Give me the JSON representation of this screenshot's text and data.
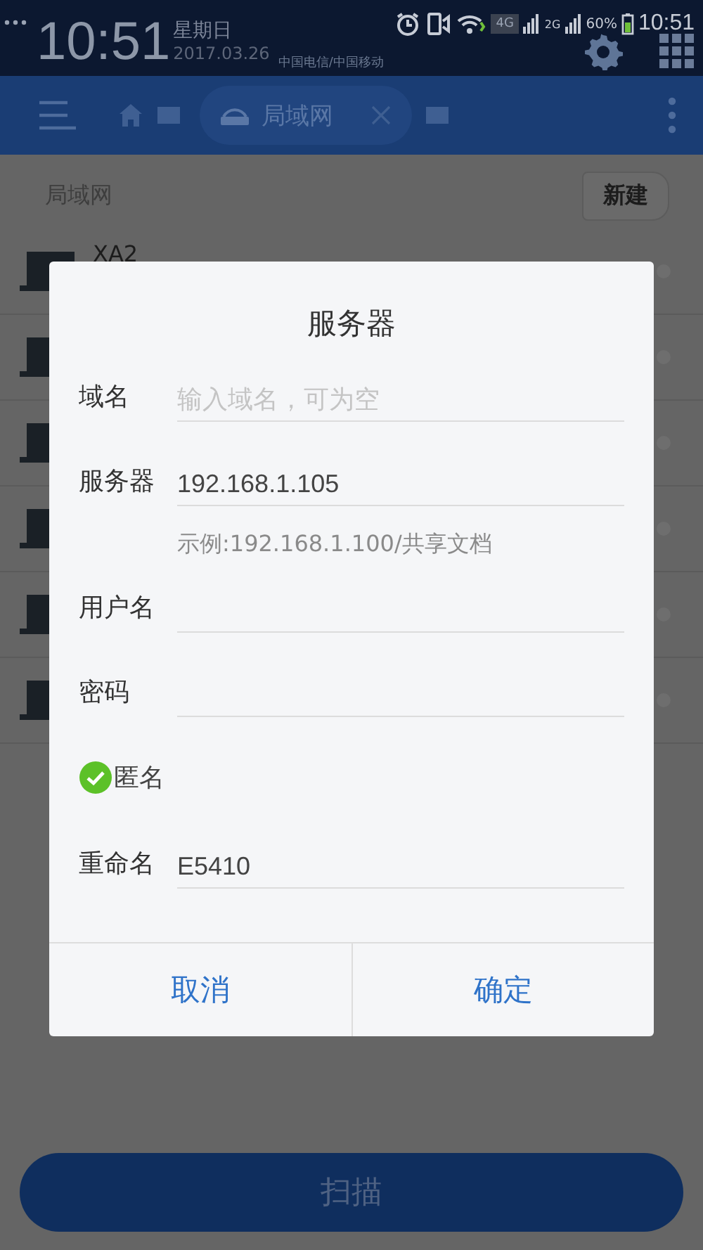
{
  "status_bar": {
    "clock": "10:51",
    "weekday": "星期日",
    "date": "2017.03.26",
    "carrier": "中国电信/中国移动",
    "network_4g": "4G",
    "network_2g": "2G",
    "battery": "60%",
    "time": "10:51"
  },
  "toolbar": {
    "tab": {
      "label": "局域网"
    }
  },
  "section": {
    "title": "局域网",
    "new_button": "新建"
  },
  "devices": [
    {
      "kind": "laptop",
      "name": "XA2"
    },
    {
      "kind": "laptop"
    },
    {
      "kind": "laptop"
    },
    {
      "kind": "laptop"
    },
    {
      "kind": "laptop"
    },
    {
      "kind": "laptop"
    }
  ],
  "dialog": {
    "title": "服务器",
    "fields": [
      {
        "kind": "text",
        "label": "域名",
        "placeholder": "输入域名，可为空"
      },
      {
        "kind": "text",
        "label": "服务器",
        "value": "192.168.1.105",
        "hint": "示例:192.168.1.100/共享文档"
      },
      {
        "kind": "text",
        "label": "用户名"
      },
      {
        "kind": "text",
        "label": "密码"
      },
      {
        "kind": "checkbox",
        "label": "匿名",
        "checked": true
      },
      {
        "kind": "text",
        "label": "重命名",
        "value": "E5410"
      }
    ],
    "buttons": [
      "取消",
      "确定"
    ]
  },
  "scan_button": "扫描"
}
